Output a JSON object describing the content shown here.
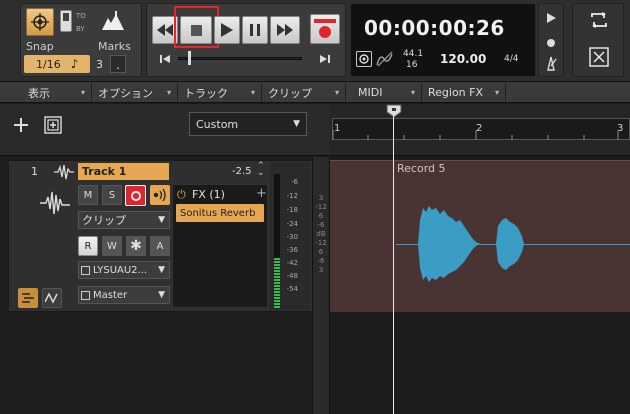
{
  "snap": {
    "label": "Snap",
    "to_by_top": "TO",
    "to_by_bottom": "BY",
    "marks_label": "Marks",
    "quantize_value": "1/16",
    "quantize_symbol": "♪",
    "quantize_count": "3",
    "quantize_dot": "."
  },
  "transport": {
    "time": "00:00:00:26",
    "sample_rate": "44.1",
    "bit_depth": "16",
    "tempo": "120.00",
    "time_signature": "4/4"
  },
  "menu": [
    "表示",
    "オプション",
    "トラック",
    "クリップ",
    "MIDI",
    "Region FX"
  ],
  "track_header": {
    "preset_value": "Custom"
  },
  "timeline": {
    "ruler_marks": [
      "1",
      "2",
      "3"
    ]
  },
  "track": {
    "number": "1",
    "name": "Track 1",
    "volume": "-2.5",
    "mute": "M",
    "solo": "S",
    "clip_label": "クリップ",
    "read": "R",
    "write": "W",
    "star": "✱",
    "auto": "A",
    "input": "LYSUAU2...",
    "output": "Master",
    "fx_title": "FX (1)",
    "fx_plugin": "Sonitus Reverb",
    "meter_scale": [
      "-6",
      "-12",
      "-18",
      "-24",
      "-30",
      "-36",
      "-42",
      "-48",
      "-54"
    ],
    "level": 0.12
  },
  "clip": {
    "name": "Record 5"
  },
  "waveform_scale": [
    "3",
    "-12",
    "6",
    "-6",
    "dB",
    "-12",
    "6",
    "-6",
    "3"
  ],
  "colors": {
    "accent_orange": "#e6a752",
    "record_red": "#e0262d",
    "highlight_red": "#e3262c",
    "clip_bg": "#4a3333",
    "wave": "#3c9dc4"
  }
}
